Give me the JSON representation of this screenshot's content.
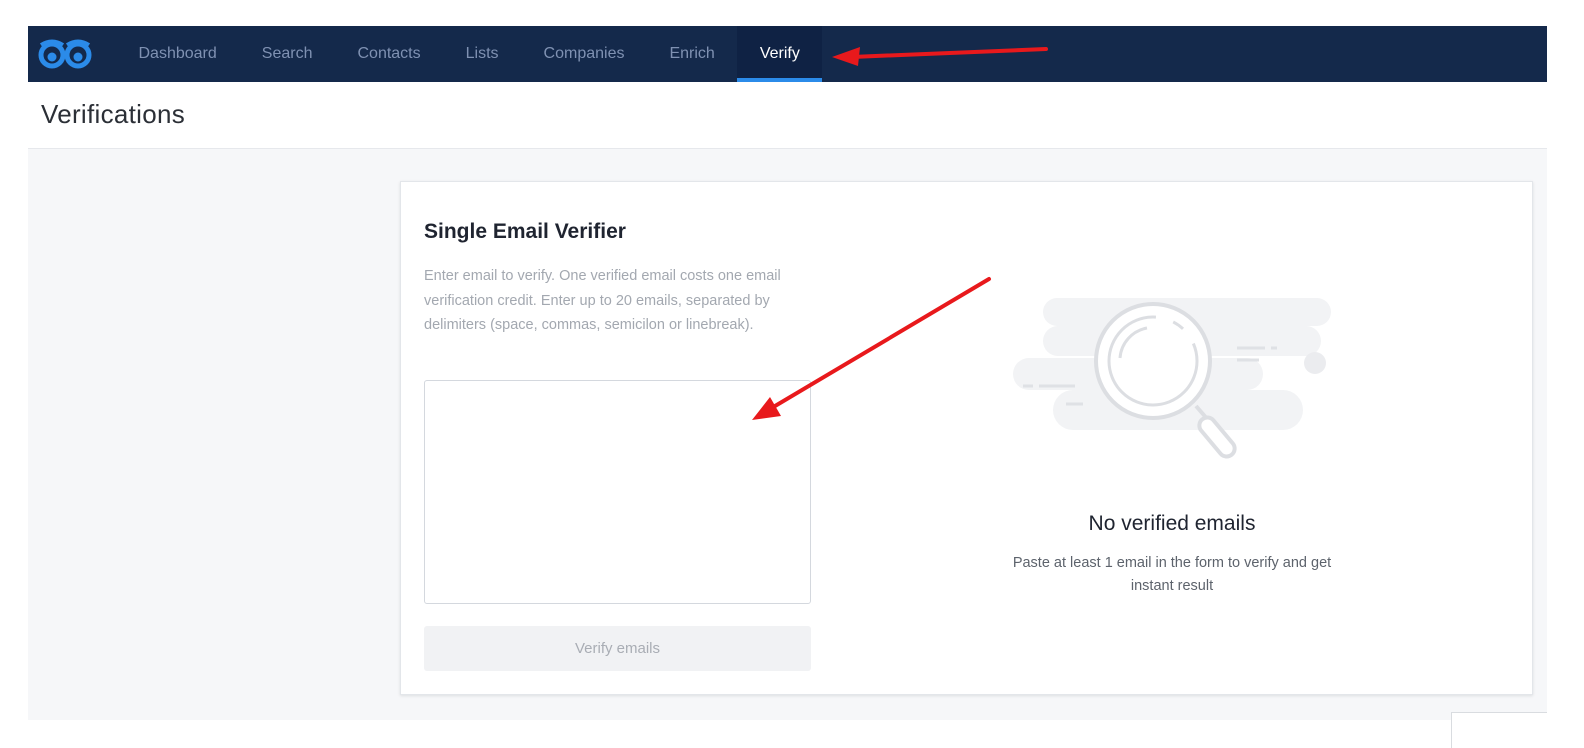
{
  "nav": {
    "items": [
      {
        "label": "Dashboard",
        "active": false
      },
      {
        "label": "Search",
        "active": false
      },
      {
        "label": "Contacts",
        "active": false
      },
      {
        "label": "Lists",
        "active": false
      },
      {
        "label": "Companies",
        "active": false
      },
      {
        "label": "Enrich",
        "active": false
      },
      {
        "label": "Verify",
        "active": true
      }
    ],
    "logo_icon": "owl-eyes-logo-icon",
    "colors": {
      "bar": "#14294b",
      "active_underline": "#2b8be9",
      "logo": "#2b8be9"
    }
  },
  "page": {
    "title": "Verifications"
  },
  "verifier": {
    "title": "Single Email Verifier",
    "description": "Enter email to verify. One verified email costs one email verification credit. Enter up to 20 emails, separated by delimiters (space, commas, semicilon or linebreak).",
    "input_value": "",
    "button_label": "Verify emails"
  },
  "empty_state": {
    "icon": "magnifying-glass-illustration",
    "title": "No verified emails",
    "description": "Paste at least 1 email in the form to verify and get instant result"
  },
  "annotations": {
    "arrow_color": "#e8191c"
  }
}
